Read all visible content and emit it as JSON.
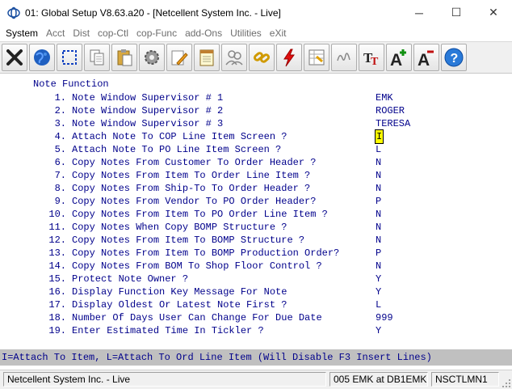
{
  "window": {
    "title": "01: Global Setup V8.63.a20 - [Netcellent System Inc. - Live]",
    "minimize": "─",
    "maximize": "☐",
    "close": "✕"
  },
  "menu": [
    {
      "label": "System",
      "active": true
    },
    {
      "label": "Acct"
    },
    {
      "label": "Dist"
    },
    {
      "label": "cop-Ctl"
    },
    {
      "label": "cop-Func"
    },
    {
      "label": "add-Ons"
    },
    {
      "label": "Utilities"
    },
    {
      "label": "eXit"
    }
  ],
  "toolbar": [
    {
      "icon": "close-x-icon",
      "name": "exit-button"
    },
    {
      "icon": "globe-icon",
      "name": "web-button"
    },
    {
      "icon": "select-icon",
      "name": "select-button"
    },
    {
      "icon": "copy-icon",
      "name": "copy-button"
    },
    {
      "icon": "paste-icon",
      "name": "paste-button"
    },
    {
      "icon": "settings-gear-icon",
      "name": "settings-button"
    },
    {
      "icon": "edit-pencil-icon",
      "name": "edit-button"
    },
    {
      "icon": "notepad-icon",
      "name": "notes-button"
    },
    {
      "icon": "users-icon",
      "name": "users-button"
    },
    {
      "icon": "chain-link-icon",
      "name": "link-button"
    },
    {
      "icon": "lightning-icon",
      "name": "run-button"
    },
    {
      "icon": "spreadsheet-icon",
      "name": "spreadsheet-button"
    },
    {
      "icon": "signature-icon",
      "name": "signature-button"
    },
    {
      "icon": "font-icon",
      "name": "font-button"
    },
    {
      "icon": "font-increase-icon",
      "name": "font-increase-button"
    },
    {
      "icon": "font-decrease-icon",
      "name": "font-decrease-button"
    },
    {
      "icon": "help-icon",
      "name": "help-button"
    }
  ],
  "screen": {
    "heading": "Note Function",
    "rows": [
      {
        "num": "1.",
        "label": "Note Window Supervisor # 1",
        "value": "EMK"
      },
      {
        "num": "2.",
        "label": "Note Window Supervisor # 2",
        "value": "ROGER"
      },
      {
        "num": "3.",
        "label": "Note Window Supervisor # 3",
        "value": "TERESA"
      },
      {
        "num": "4.",
        "label": "Attach Note To COP Line Item Screen ?",
        "value": "I",
        "cursor": true
      },
      {
        "num": "5.",
        "label": "Attach Note To PO Line Item Screen ?",
        "value": "L"
      },
      {
        "num": "6.",
        "label": "Copy Notes From Customer To Order Header ?",
        "value": "N"
      },
      {
        "num": "7.",
        "label": "Copy Notes From Item To Order Line Item ?",
        "value": "N"
      },
      {
        "num": "8.",
        "label": "Copy Notes From Ship-To To Order Header ?",
        "value": "N"
      },
      {
        "num": "9.",
        "label": "Copy Notes From Vendor To PO Order Header?",
        "value": "P"
      },
      {
        "num": "10.",
        "label": "Copy Notes From Item To PO Order Line Item ?",
        "value": "N"
      },
      {
        "num": "11.",
        "label": "Copy Notes When Copy BOMP Structure ?",
        "value": "N"
      },
      {
        "num": "12.",
        "label": "Copy Notes From Item To BOMP Structure ?",
        "value": "N"
      },
      {
        "num": "13.",
        "label": "Copy Notes From Item To BOMP Production Order?",
        "value": "P"
      },
      {
        "num": "14.",
        "label": "Copy Notes From BOM To Shop Floor Control ?",
        "value": "N"
      },
      {
        "num": "15.",
        "label": "Protect Note Owner ?",
        "value": "Y"
      },
      {
        "num": "16.",
        "label": "Display Function Key Message For Note",
        "value": "Y"
      },
      {
        "num": "17.",
        "label": "Display Oldest Or Latest Note First ?",
        "value": "L"
      },
      {
        "num": "18.",
        "label": "Number Of Days User Can Change For Due Date",
        "value": "999"
      },
      {
        "num": "19.",
        "label": "Enter Estimated Time In Tickler ?",
        "value": "Y"
      }
    ]
  },
  "help_line": "I=Attach To Item, L=Attach To Ord Line Item (Will Disable F3 Insert Lines)",
  "status": {
    "company": "Netcellent System Inc. - Live",
    "user": "005 EMK at DB1EMK",
    "program": "NSCTLMN1"
  },
  "colors": {
    "screen_text": "#00008b",
    "help_bg": "#c0c0c0",
    "cursor_bg": "#ffff00"
  }
}
